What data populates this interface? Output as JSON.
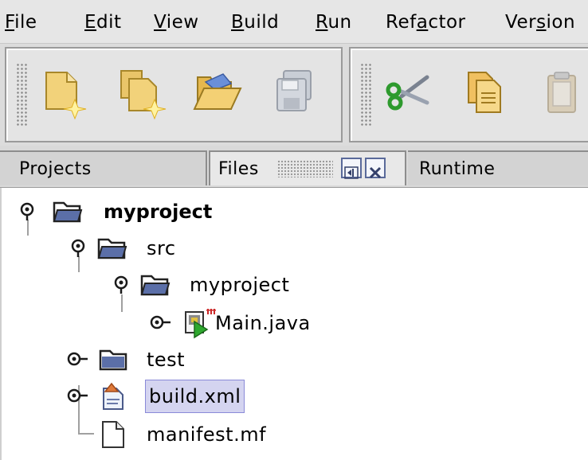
{
  "menu": {
    "file": {
      "mnemonic": "F",
      "rest": "ile"
    },
    "edit": {
      "mnemonic": "E",
      "rest": "dit"
    },
    "view": {
      "mnemonic": "V",
      "rest": "iew"
    },
    "build": {
      "mnemonic": "B",
      "rest": "uild"
    },
    "run": {
      "mnemonic": "R",
      "rest": "un"
    },
    "refactor": {
      "pre": "Ref",
      "mnemonic": "a",
      "rest": "ctor"
    },
    "versioning": {
      "pre": "Ver",
      "mnemonic": "s",
      "rest": "ion"
    }
  },
  "toolbar": {
    "icons": [
      "new-file-icon",
      "new-project-icon",
      "open-project-icon",
      "save-all-icon",
      "cut-icon",
      "copy-icon",
      "paste-icon"
    ]
  },
  "tabs": {
    "projects": "Projects",
    "files": "Files",
    "runtime": "Runtime"
  },
  "tree": {
    "root": "myproject",
    "src": "src",
    "package": "myproject",
    "main": "Main.java",
    "test": "test",
    "build": "build.xml",
    "manifest": "manifest.mf"
  },
  "colors": {
    "selection": "#d4d4f0",
    "folder_blue": "#5b6fa8"
  }
}
